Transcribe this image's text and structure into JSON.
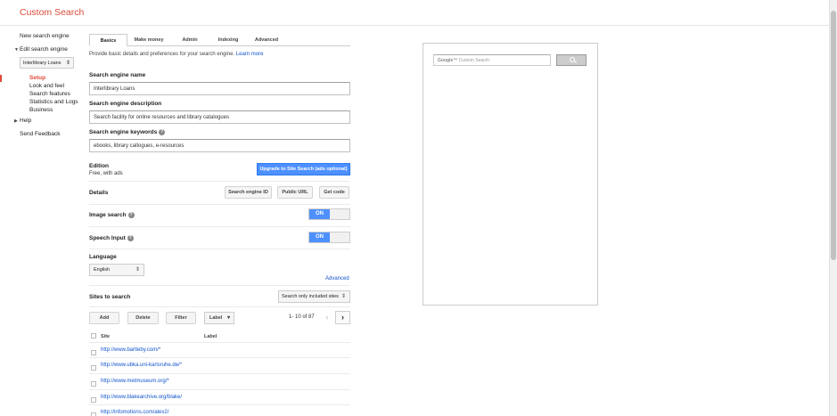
{
  "app": {
    "title": "Custom Search"
  },
  "sidebar": {
    "new_engine": "New search engine",
    "edit_engine": "Edit search engine",
    "engine_select": "Interlibrary Loans",
    "items": [
      "Setup",
      "Look and feel",
      "Search features",
      "Statistics and Logs",
      "Business"
    ],
    "help": "Help",
    "feedback": "Send Feedback"
  },
  "tabs": [
    "Basics",
    "Make money",
    "Admin",
    "Indexing",
    "Advanced"
  ],
  "intro": {
    "text": "Provide basic details and preferences for your search engine.",
    "learn_more": "Learn more"
  },
  "form": {
    "name_label": "Search engine name",
    "name_value": "Interlibrary Loans",
    "description_label": "Search engine description",
    "description_value": "Search facility for online resources and library catalogues",
    "keywords_label": "Search engine keywords",
    "keywords_value": "ebooks, library catlogues, e-resources",
    "edition_label": "Edition",
    "edition_value": "Free, with ads",
    "upgrade_button": "Upgrade to Site Search (ads optional)",
    "details_label": "Details",
    "details_buttons": [
      "Search engine ID",
      "Public URL",
      "Get code"
    ],
    "image_search_label": "Image search",
    "image_search_state": "ON",
    "speech_input_label": "Speech Input",
    "speech_input_state": "ON",
    "language_label": "Language",
    "language_value": "English",
    "advanced_link": "Advanced",
    "sites_label": "Sites to search",
    "sites_select": "Search only included sites"
  },
  "sites_toolbar": {
    "add": "Add",
    "delete": "Delete",
    "filter": "Filter",
    "label": "Label",
    "pager": "1- 10 of 87"
  },
  "sites_table": {
    "columns": [
      "Site",
      "Label"
    ],
    "rows": [
      "http://www.bartleby.com/*",
      "http://www.ubka.uni-karlsruhe.de/*",
      "http://www.metmuseum.org/*",
      "http://www.blakearchive.org/blake/",
      "http://infomotions.com/alex2/"
    ]
  },
  "preview": {
    "google_word": "Google™",
    "placeholder": "Custom Search"
  },
  "icons": [
    "help-icon",
    "chevron-updown-icon",
    "chevron-left-icon",
    "chevron-right-icon",
    "search-icon"
  ],
  "colors": {
    "brand_red": "#dd4b39",
    "accent_blue": "#4d90fe",
    "link_blue": "#1155cc"
  }
}
